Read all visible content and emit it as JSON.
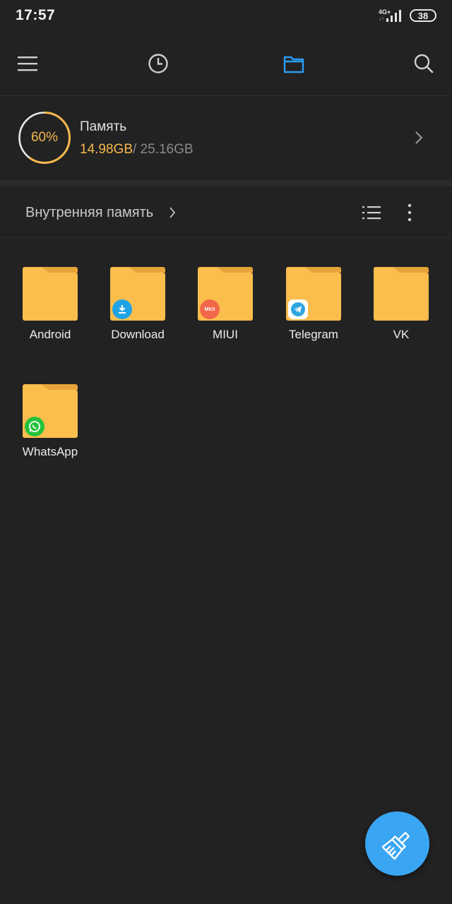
{
  "status_bar": {
    "time": "17:57",
    "network": "4G+",
    "network_arrows": "↓↑",
    "battery": "38"
  },
  "toolbar": {
    "menu_icon": "hamburger-menu-icon",
    "recent_icon": "clock-icon",
    "files_icon": "folder-icon",
    "search_icon": "search-icon",
    "active_color": "#2a9df4"
  },
  "storage": {
    "percent_label": "60%",
    "percent_value": 0.6,
    "title": "Память",
    "used": "14.98GB",
    "total": "/ 25.16GB",
    "accent": "#f5b84c"
  },
  "path": {
    "label": "Внутренняя память"
  },
  "folders": [
    {
      "name": "Android",
      "badge": null
    },
    {
      "name": "Download",
      "badge": "download-icon"
    },
    {
      "name": "MIUI",
      "badge": "miui-icon",
      "badge_text": "MIUI"
    },
    {
      "name": "Telegram",
      "badge": "telegram-icon"
    },
    {
      "name": "VK",
      "badge": null
    },
    {
      "name": "WhatsApp",
      "badge": "whatsapp-icon"
    }
  ],
  "fab": {
    "icon": "brush-clean-icon",
    "color": "#3aa5f3"
  }
}
